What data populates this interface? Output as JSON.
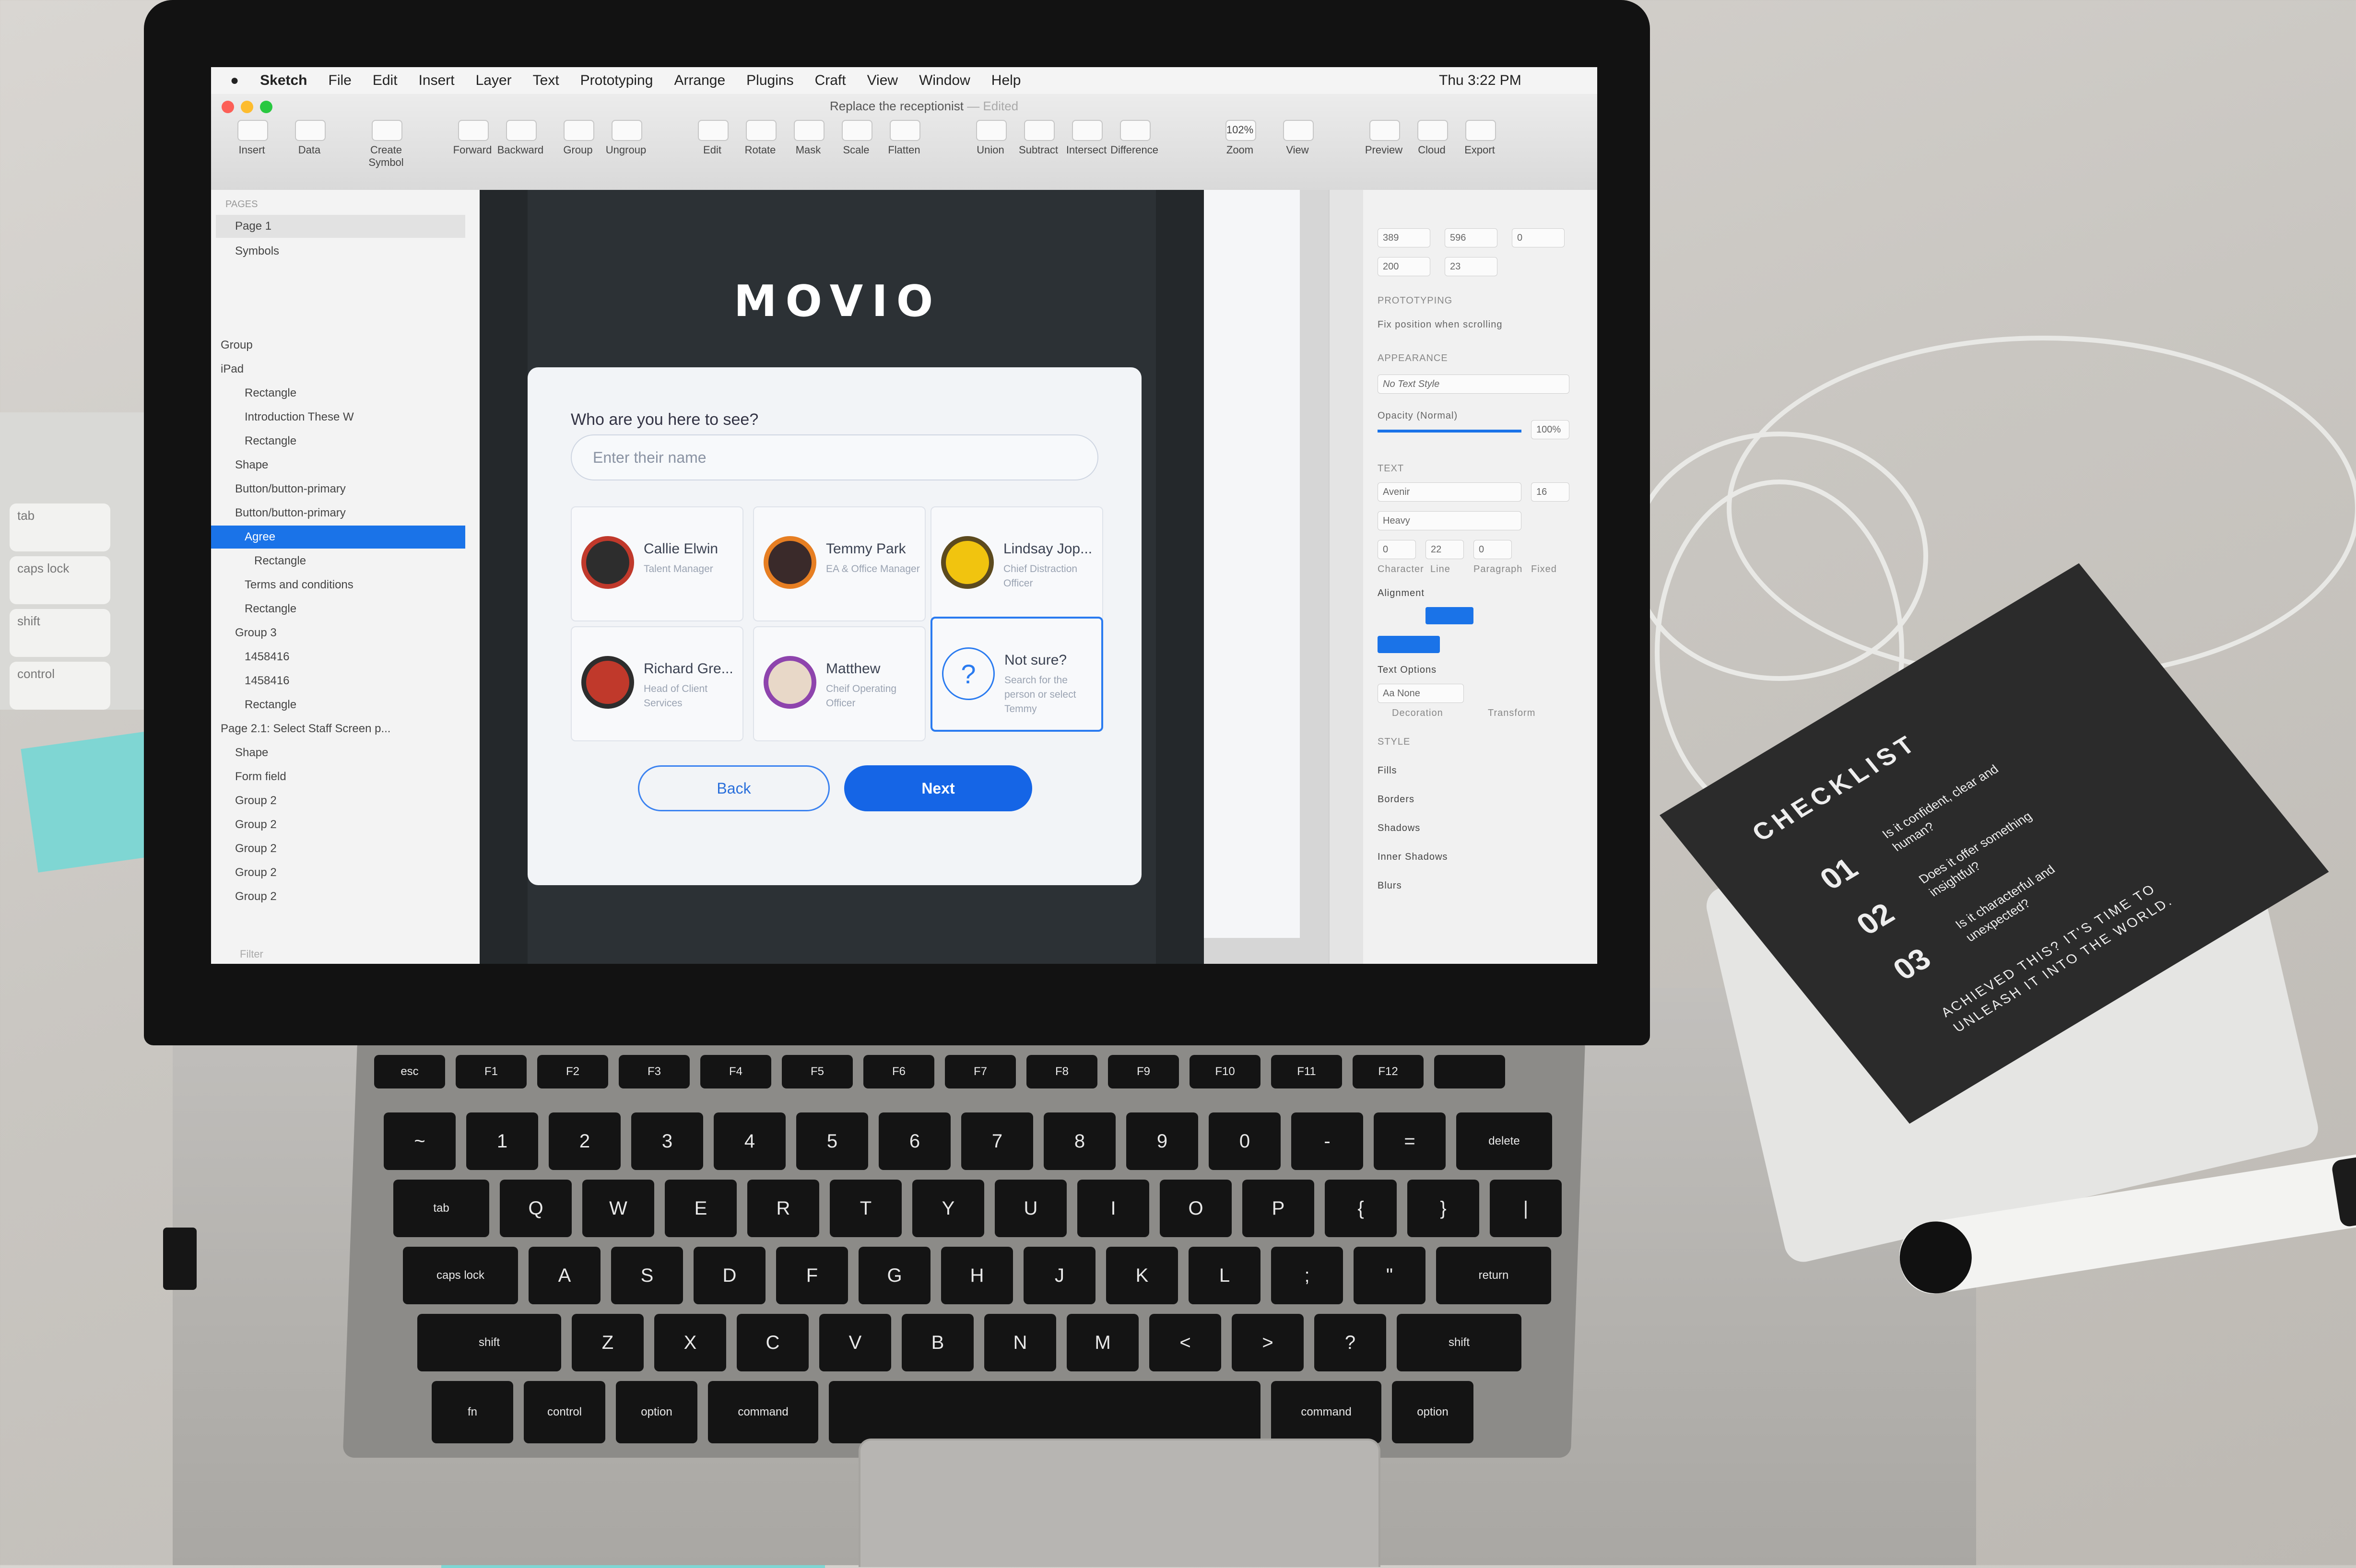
{
  "menubar": {
    "app": "Sketch",
    "items": [
      "File",
      "Edit",
      "Insert",
      "Layer",
      "Text",
      "Prototyping",
      "Arrange",
      "Plugins",
      "Craft",
      "View",
      "Window",
      "Help"
    ],
    "clock": "Thu 3:22 PM"
  },
  "document": {
    "title": "Replace the receptionist",
    "state": "— Edited"
  },
  "toolbar": {
    "tools": [
      "Insert",
      "Data",
      "Create Symbol",
      "Forward",
      "Backward",
      "Group",
      "Ungroup",
      "Edit",
      "Rotate",
      "Mask",
      "Scale",
      "Flatten",
      "Union",
      "Subtract",
      "Intersect",
      "Difference",
      "Zoom",
      "View",
      "Preview",
      "Cloud",
      "Export"
    ],
    "zoom": "102%"
  },
  "layers": {
    "pages_header": "PAGES",
    "pages": [
      "Page 1",
      "Symbols"
    ],
    "items": [
      "Group",
      "iPad",
      "Rectangle",
      "Introduction These W",
      "Rectangle",
      "Shape",
      "Button/button-primary",
      "Button/button-primary",
      "Agree",
      "Rectangle",
      "Terms and conditions",
      "Rectangle",
      "Group 3",
      "1458416",
      "1458416",
      "Rectangle",
      "Page 2.1: Select Staff Screen p...",
      "Shape",
      "Form field",
      "Group 2",
      "Group 2",
      "Group 2",
      "Group 2",
      "Group 2"
    ],
    "selected_index": 8,
    "filter_placeholder": "Filter"
  },
  "artboard": {
    "brand": "MOVIO",
    "question": "Who are you here to see?",
    "search_placeholder": "Enter their name",
    "people": [
      {
        "name": "Callie Elwin",
        "role": "Talent Manager",
        "color": "#c0392b"
      },
      {
        "name": "Temmy Park",
        "role": "EA & Office Manager",
        "color": "#e67e22"
      },
      {
        "name": "Lindsay Jop...",
        "role": "Chief Distraction Officer",
        "color": "#f1c40f"
      },
      {
        "name": "Richard Gre...",
        "role": "Head of Client Services",
        "color": "#c0392b"
      },
      {
        "name": "Matthew",
        "role": "Cheif Operating Officer",
        "color": "#7f8c8d"
      },
      {
        "name": "Not sure?",
        "role": "Search for the person or select Temmy",
        "color": "#2a7bf0"
      }
    ],
    "back_label": "Back",
    "next_label": "Next"
  },
  "inspector": {
    "x": "389",
    "y": "596",
    "rotation": "0",
    "w": "200",
    "h": "23",
    "prototyping_label": "PROTOTYPING",
    "fix_position": "Fix position when scrolling",
    "appearance_label": "APPEARANCE",
    "text_style": "No Text Style",
    "opacity_label": "Opacity (Normal)",
    "opacity_value": "100%",
    "text_label": "TEXT",
    "font": "Avenir",
    "font_size": "16",
    "weight": "Heavy",
    "spacing": [
      "0",
      "22",
      "0"
    ],
    "spacing_labels": [
      "Character",
      "Line",
      "Paragraph",
      "Fixed"
    ],
    "alignment_label": "Alignment",
    "text_options_label": "Text Options",
    "decoration": "Aa None",
    "decoration_label": "Decoration",
    "transform_label": "Transform",
    "style_label": "STYLE",
    "sections": [
      "Fills",
      "Borders",
      "Shadows",
      "Inner Shadows",
      "Blurs"
    ]
  },
  "keyboard": {
    "row1": [
      "esc",
      "F1",
      "F2",
      "F3",
      "F4",
      "F5",
      "F6",
      "F7",
      "F8",
      "F9",
      "F10",
      "F11",
      "F12",
      ""
    ],
    "row2": [
      "~",
      "1",
      "2",
      "3",
      "4",
      "5",
      "6",
      "7",
      "8",
      "9",
      "0",
      "-",
      "=",
      "delete"
    ],
    "row3": [
      "tab",
      "Q",
      "W",
      "E",
      "R",
      "T",
      "Y",
      "U",
      "I",
      "O",
      "P",
      "{",
      "}",
      "|"
    ],
    "row4": [
      "caps lock",
      "A",
      "S",
      "D",
      "F",
      "G",
      "H",
      "J",
      "K",
      "L",
      ";",
      "\"",
      "return"
    ],
    "row5": [
      "shift",
      "Z",
      "X",
      "C",
      "V",
      "B",
      "N",
      "M",
      "<",
      ">",
      "?",
      "shift"
    ],
    "row6": [
      "fn",
      "control",
      "option",
      "command",
      "",
      "command",
      "option"
    ],
    "side_keys": [
      "caps lock",
      "shift",
      "control",
      "tab"
    ]
  },
  "checklist": {
    "title": "CHECKLIST",
    "items": [
      {
        "num": "01",
        "text": "Is it confident, clear and human?"
      },
      {
        "num": "02",
        "text": "Does it offer something insightful?"
      },
      {
        "num": "03",
        "text": "Is it characterful and unexpected?"
      }
    ],
    "footer": "ACHIEVED THIS? IT'S TIME TO UNLEASH IT INTO THE WORLD."
  },
  "colors": {
    "accent": "#1565e6",
    "selection": "#1a73e8",
    "artboard": "#2c3135"
  }
}
